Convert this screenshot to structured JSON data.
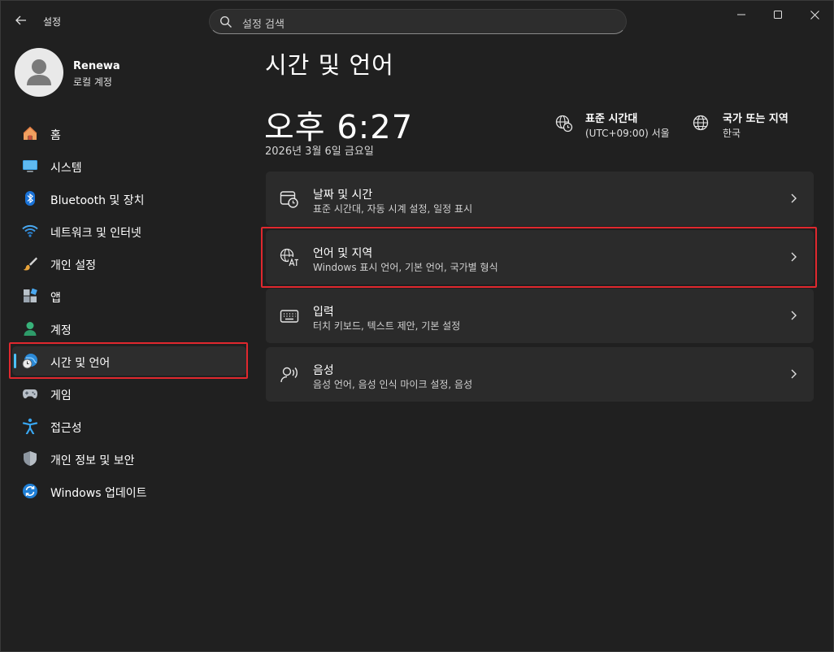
{
  "app": {
    "title": "설정"
  },
  "search": {
    "placeholder": "설정 검색"
  },
  "window_controls": [
    "minimize",
    "maximize",
    "close"
  ],
  "profile": {
    "name": "Renewa",
    "account_type": "로컬 계정"
  },
  "sidebar": {
    "items": [
      {
        "label": "홈",
        "icon": "home-icon"
      },
      {
        "label": "시스템",
        "icon": "system-icon"
      },
      {
        "label": "Bluetooth 및 장치",
        "icon": "bluetooth-icon"
      },
      {
        "label": "네트워크 및 인터넷",
        "icon": "wifi-icon"
      },
      {
        "label": "개인 설정",
        "icon": "brush-icon"
      },
      {
        "label": "앱",
        "icon": "apps-icon"
      },
      {
        "label": "계정",
        "icon": "account-icon"
      },
      {
        "label": "시간 및 언어",
        "icon": "time-language-icon",
        "selected": true
      },
      {
        "label": "게임",
        "icon": "gamepad-icon"
      },
      {
        "label": "접근성",
        "icon": "accessibility-icon"
      },
      {
        "label": "개인 정보 및 보안",
        "icon": "shield-icon"
      },
      {
        "label": "Windows 업데이트",
        "icon": "update-icon"
      }
    ]
  },
  "main": {
    "title": "시간 및 언어",
    "clock": "오후 6:27",
    "date": "2026년 3월 6일 금요일",
    "timezone": {
      "title": "표준 시간대",
      "value": "(UTC+09:00) 서울"
    },
    "region": {
      "title": "국가 또는 지역",
      "value": "한국"
    },
    "cards": [
      {
        "title": "날짜 및 시간",
        "subtitle": "표준 시간대, 자동 시계 설정, 일정 표시",
        "icon": "calendar-clock-icon"
      },
      {
        "title": "언어 및 지역",
        "subtitle": "Windows 표시 언어, 기본 언어, 국가별 형식",
        "icon": "language-icon",
        "highlighted": true
      },
      {
        "title": "입력",
        "subtitle": "터치 키보드, 텍스트 제안, 기본 설정",
        "icon": "keyboard-icon"
      },
      {
        "title": "음성",
        "subtitle": "음성 언어, 음성 인식 마이크 설정, 음성",
        "icon": "speech-icon"
      }
    ]
  },
  "colors": {
    "accent": "#4cc2ff",
    "highlight_border": "#e0282e",
    "background": "#202020",
    "card": "#2b2b2b"
  }
}
